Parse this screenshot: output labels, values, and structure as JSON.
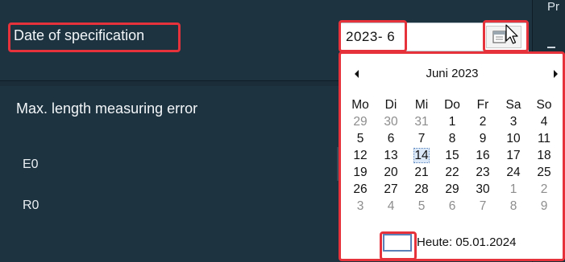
{
  "form": {
    "date_label": "Date of specification",
    "date_value": "2023-  6",
    "error_title": "Max. length measuring error",
    "e0_label": "E0",
    "r0_label": "R0",
    "right_strip_text": "Pr"
  },
  "calendar": {
    "month_label": "Juni 2023",
    "weekdays": [
      "Mo",
      "Di",
      "Mi",
      "Do",
      "Fr",
      "Sa",
      "So"
    ],
    "weeks": [
      [
        "29",
        "30",
        "31",
        "1",
        "2",
        "3",
        "4"
      ],
      [
        "5",
        "6",
        "7",
        "8",
        "9",
        "10",
        "11"
      ],
      [
        "12",
        "13",
        "14",
        "15",
        "16",
        "17",
        "18"
      ],
      [
        "19",
        "20",
        "21",
        "22",
        "23",
        "24",
        "25"
      ],
      [
        "26",
        "27",
        "28",
        "29",
        "30",
        "1",
        "2"
      ],
      [
        "3",
        "4",
        "5",
        "6",
        "7",
        "8",
        "9"
      ]
    ],
    "selected_day": "14",
    "today_label": "Heute: 05.01.2024"
  },
  "icons": {
    "calendar_button": "calendar-icon",
    "prev": "triangle-left-icon",
    "next": "triangle-right-icon",
    "cursor": "mouse-cursor-icon"
  },
  "colors": {
    "highlight": "#e5323b",
    "background": "#1e3340"
  }
}
